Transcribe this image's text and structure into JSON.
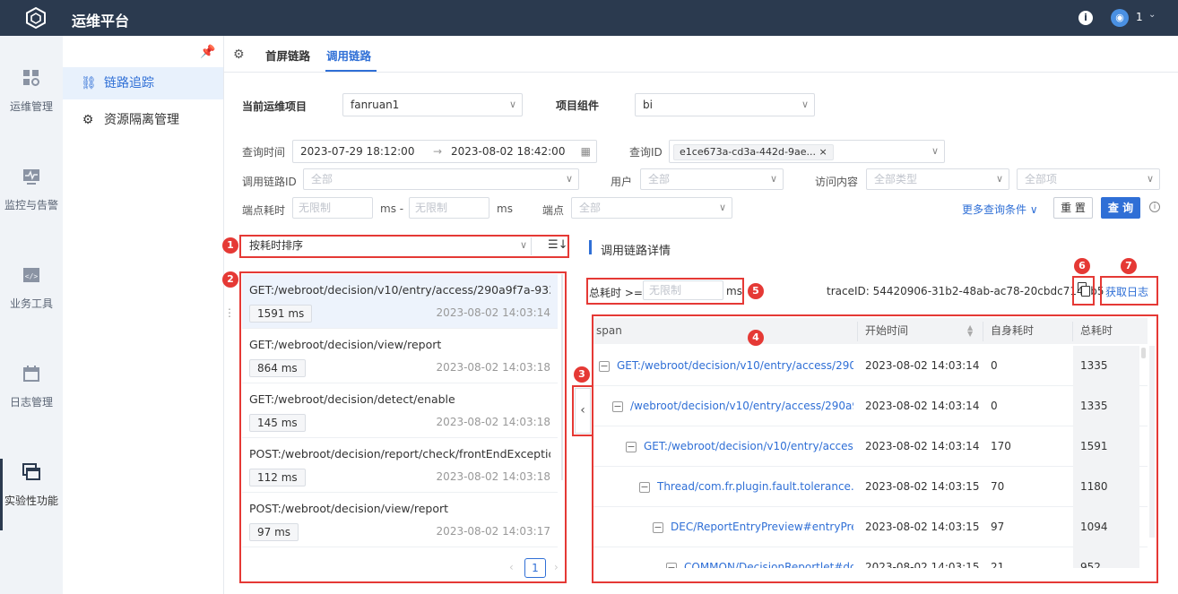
{
  "header": {
    "title": "运维平台",
    "user_num": "1"
  },
  "leftnav": {
    "items": [
      {
        "label": "运维管理",
        "icon": "grid-settings-icon"
      },
      {
        "label": "监控与告警",
        "icon": "monitor-icon"
      },
      {
        "label": "业务工具",
        "icon": "code-window-icon"
      },
      {
        "label": "日志管理",
        "icon": "calendar-icon"
      },
      {
        "label": "实验性功能",
        "icon": "windows-stack-icon"
      }
    ]
  },
  "subnav": {
    "items": [
      {
        "label": "链路追踪",
        "icon": "link-trace-icon"
      },
      {
        "label": "资源隔离管理",
        "icon": "resource-isolation-icon"
      }
    ]
  },
  "tabs": [
    {
      "label": "首屏链路"
    },
    {
      "label": "调用链路"
    }
  ],
  "filters": {
    "project_label": "当前运维项目",
    "project_value": "fanruan1",
    "component_label": "项目组件",
    "component_value": "bi",
    "time_label": "查询时间",
    "time_start": "2023-07-29 18:12:00",
    "time_arrow": "→",
    "time_end": "2023-08-02 18:42:00",
    "query_id_label": "查询ID",
    "query_id_value": "e1ce673a-cd3a-442d-9ae...",
    "query_id_close": "×",
    "trace_id_label": "调用链路ID",
    "trace_id_placeholder": "全部",
    "user_label": "用户",
    "user_placeholder": "全部",
    "content_label": "访问内容",
    "content_type_placeholder": "全部类型",
    "content_item_placeholder": "全部项",
    "endpoint_time_label": "端点耗时",
    "time_min_placeholder": "无限制",
    "ms_dash": "ms -",
    "time_max_placeholder": "无限制",
    "ms": "ms",
    "endpoint_label": "端点",
    "endpoint_placeholder": "全部",
    "more_label": "更多查询条件",
    "reset_label": "重 置",
    "search_label": "查 询"
  },
  "list": {
    "sort_label": "按耗时排序",
    "items": [
      {
        "title": "GET:/webroot/decision/v10/entry/access/290a9f7a-933a-49...",
        "duration": "1591 ms",
        "time": "2023-08-02 14:03:14"
      },
      {
        "title": "GET:/webroot/decision/view/report",
        "duration": "864 ms",
        "time": "2023-08-02 14:03:18"
      },
      {
        "title": "GET:/webroot/decision/detect/enable",
        "duration": "145 ms",
        "time": "2023-08-02 14:03:18"
      },
      {
        "title": "POST:/webroot/decision/report/check/frontEndException",
        "duration": "112 ms",
        "time": "2023-08-02 14:03:18"
      },
      {
        "title": "POST:/webroot/decision/view/report",
        "duration": "97 ms",
        "time": "2023-08-02 14:03:17"
      }
    ],
    "page": "1"
  },
  "detail": {
    "title": "调用链路详情",
    "total_time_label": "总耗时 >=",
    "total_time_placeholder": "无限制",
    "ms": "ms",
    "trace_id": "traceID: 54420906-31b2-48ab-ac78-20cbdc7143b5",
    "get_log_label": "获取日志",
    "columns": [
      "span",
      "开始时间",
      "自身耗时",
      "总耗时"
    ],
    "rows": [
      {
        "span": "GET:/webroot/decision/v10/entry/access/290a...",
        "start": "2023-08-02 14:03:14",
        "self": "0",
        "total": "1335",
        "indent": 0
      },
      {
        "span": "/webroot/decision/v10/entry/access/290a9f...",
        "start": "2023-08-02 14:03:14",
        "self": "0",
        "total": "1335",
        "indent": 1
      },
      {
        "span": "GET:/webroot/decision/v10/entry/access/...",
        "start": "2023-08-02 14:03:14",
        "self": "170",
        "total": "1591",
        "indent": 2
      },
      {
        "span": "Thread/com.fr.plugin.fault.tolerance.is...",
        "start": "2023-08-02 14:03:15",
        "self": "70",
        "total": "1180",
        "indent": 3
      },
      {
        "span": "DEC/ReportEntryPreview#entryPrevi...",
        "start": "2023-08-02 14:03:15",
        "self": "97",
        "total": "1094",
        "indent": 4
      },
      {
        "span": "COMMON/DecisionReportlet#do...",
        "start": "2023-08-02 14:03:15",
        "self": "21",
        "total": "952",
        "indent": 5
      }
    ]
  },
  "annotations": [
    "1",
    "2",
    "3",
    "4",
    "5",
    "6",
    "7"
  ],
  "colors": {
    "topbar": "#2b3a4f",
    "accent": "#2f6fd6",
    "annotation_red": "#e53935"
  }
}
